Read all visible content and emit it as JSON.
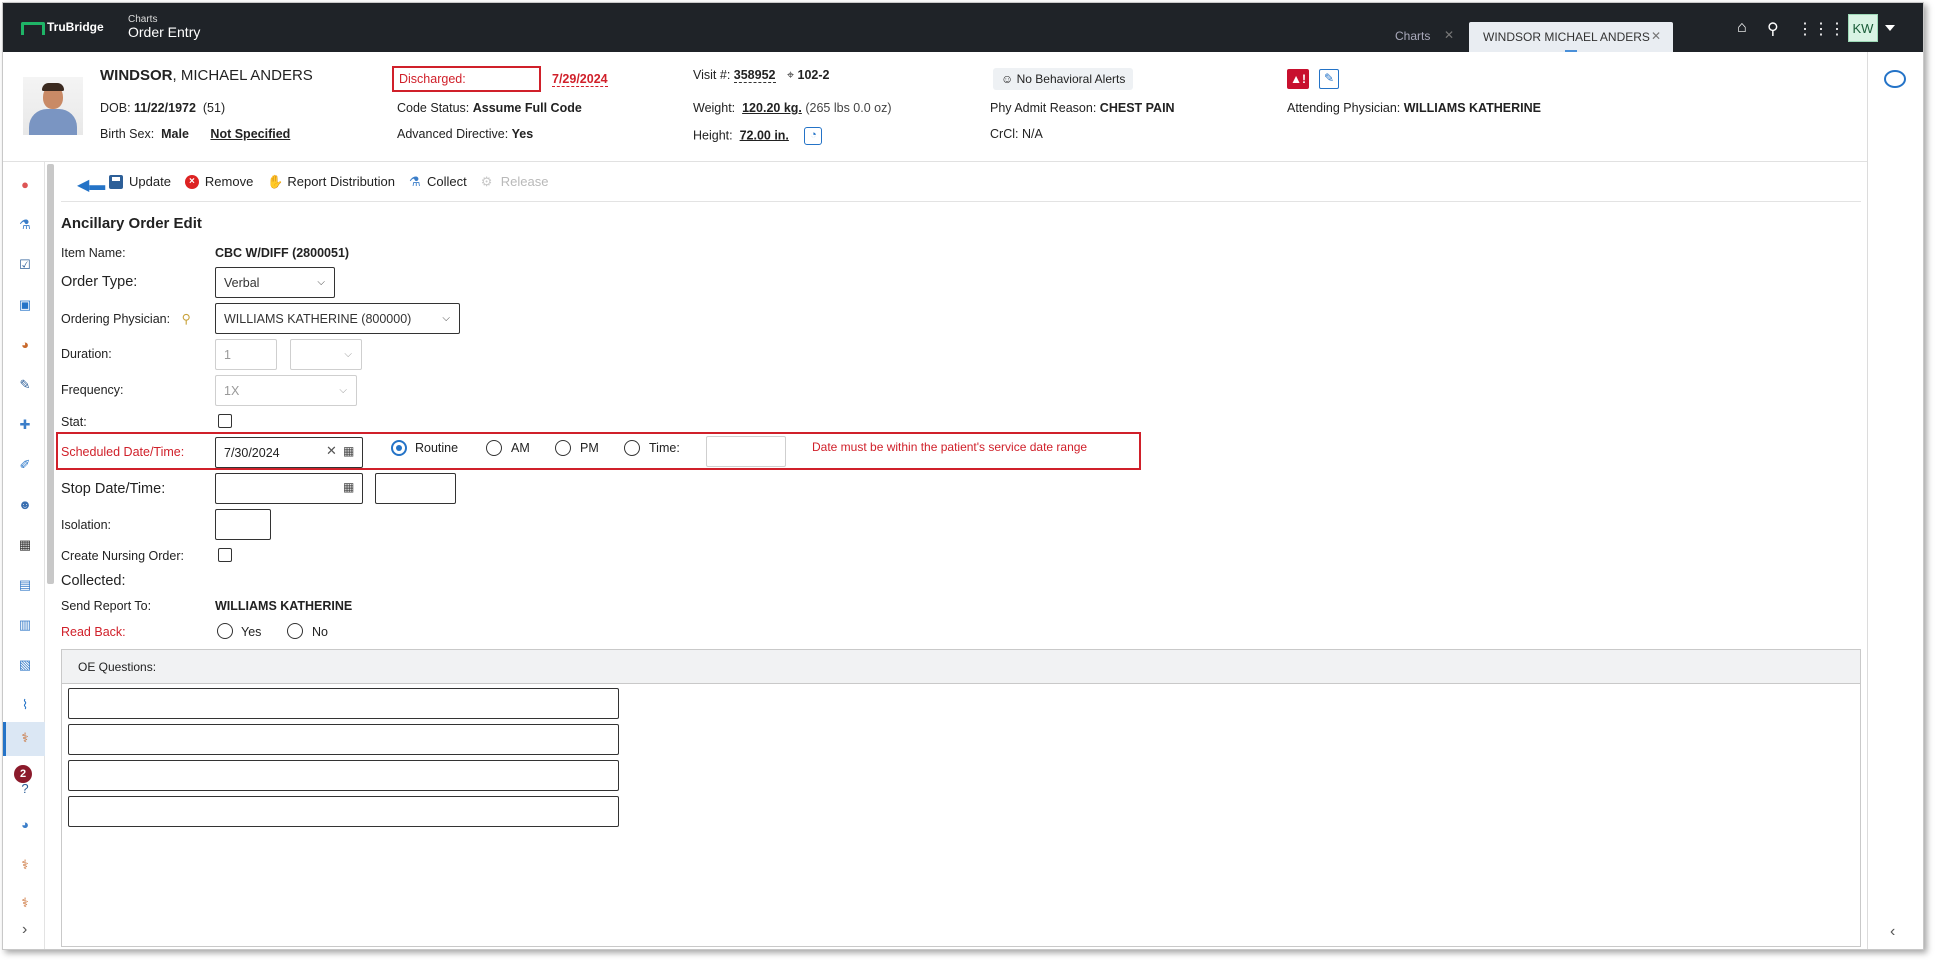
{
  "topbar": {
    "logo_text": "TruBridge",
    "app_small": "Charts",
    "app_title": "Order Entry",
    "tabs": [
      {
        "label": "Charts",
        "close": "✕"
      },
      {
        "label": "WINDSOR MICHAEL ANDERS",
        "close": "✕"
      }
    ],
    "icons": [
      "home-icon",
      "search-icon",
      "apps-grid-icon"
    ],
    "user_initials": "KW"
  },
  "patient": {
    "last_name": "WINDSOR",
    "first_names": ", MICHAEL ANDERS",
    "dob_label": "DOB:",
    "dob": "11/22/1972",
    "age": "(51)",
    "birth_sex_label": "Birth Sex:",
    "birth_sex": "Male",
    "gender_identity": "Not Specified",
    "discharged_label": "Discharged:",
    "discharged": "7/29/2024",
    "code_status_label": "Code Status:",
    "code_status": "Assume Full Code",
    "adv_directive_label": "Advanced Directive:",
    "adv_directive": "Yes",
    "visit_label": "Visit #:",
    "visit": "358952",
    "room": "102-2",
    "weight_label": "Weight:",
    "weight": "120.20 kg.",
    "weight_lbs": "(265 lbs 0.0 oz)",
    "height_label": "Height:",
    "height": "72.00 in.",
    "behavioral_alerts": "No Behavioral Alerts",
    "admit_reason_label": "Phy Admit Reason:",
    "admit_reason": "CHEST PAIN",
    "crcl_label": "CrCl:",
    "crcl": "N/A",
    "attending_label": "Attending Physician:",
    "attending": "WILLIAMS KATHERINE"
  },
  "toolbar": {
    "update": "Update",
    "remove": "Remove",
    "report_distribution": "Report Distribution",
    "collect": "Collect",
    "release": "Release"
  },
  "form": {
    "title": "Ancillary Order Edit",
    "item_name_label": "Item Name:",
    "item_name": "CBC W/DIFF (2800051)",
    "order_type_label": "Order Type:",
    "order_type": "Verbal",
    "ordering_physician_label": "Ordering Physician:",
    "ordering_physician": "WILLIAMS KATHERINE (800000)",
    "duration_label": "Duration:",
    "duration": "1",
    "duration_unit": "",
    "frequency_label": "Frequency:",
    "frequency": "1X",
    "stat_label": "Stat:",
    "scheduled_label": "Scheduled Date/Time:",
    "scheduled_date": "7/30/2024",
    "radio_routine": "Routine",
    "radio_am": "AM",
    "radio_pm": "PM",
    "radio_time": "Time:",
    "scheduled_error": "Date must be within the patient's service date range",
    "stop_label": "Stop Date/Time:",
    "isolation_label": "Isolation:",
    "nursing_label": "Create Nursing Order:",
    "collected_label": "Collected:",
    "send_report_label": "Send Report To:",
    "send_report": "WILLIAMS KATHERINE",
    "read_back_label": "Read Back:",
    "read_back_yes": "Yes",
    "read_back_no": "No",
    "oe_questions_label": "OE Questions:"
  },
  "leftnav": {
    "badge_count": "2"
  },
  "colors": {
    "error_red": "#d0202a",
    "accent_blue": "#2473c7",
    "topbar_bg": "#1f2328"
  }
}
